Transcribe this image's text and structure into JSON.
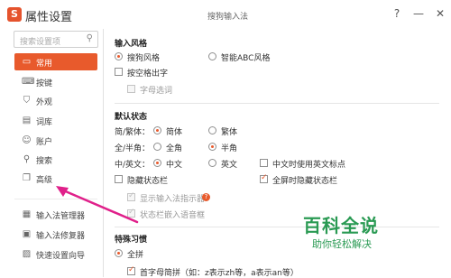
{
  "window": {
    "title": "属性设置",
    "center_title": "搜狗输入法",
    "logo_text": "S",
    "help": "?",
    "minimize": "—",
    "close": "✕"
  },
  "sidebar": {
    "search_placeholder": "搜索设置项",
    "items": [
      {
        "label": "常用",
        "icon": "monitor-icon",
        "glyph": "▭"
      },
      {
        "label": "按键",
        "icon": "keyboard-icon",
        "glyph": "⌨"
      },
      {
        "label": "外观",
        "icon": "shirt-icon",
        "glyph": "⛉"
      },
      {
        "label": "词库",
        "icon": "book-icon",
        "glyph": "▤"
      },
      {
        "label": "账户",
        "icon": "user-icon",
        "glyph": "☺"
      },
      {
        "label": "搜索",
        "icon": "search-icon",
        "glyph": "⚲"
      },
      {
        "label": "高级",
        "icon": "advanced-icon",
        "glyph": "❐"
      }
    ],
    "bottom_items": [
      {
        "label": "输入法管理器",
        "icon": "grid-icon",
        "glyph": "▦"
      },
      {
        "label": "输入法修复器",
        "icon": "repair-icon",
        "glyph": "▣"
      },
      {
        "label": "快速设置向导",
        "icon": "wizard-icon",
        "glyph": "▨"
      }
    ]
  },
  "input_style": {
    "heading": "输入风格",
    "option1": "搜狗风格",
    "option2": "智能ABC风格",
    "space_output": "按空格出字",
    "letter_select": "字母选词"
  },
  "default_state": {
    "heading": "默认状态",
    "simp_trad_label": "简/繁体：",
    "simplified": "简体",
    "traditional": "繁体",
    "width_label": "全/半角：",
    "full_width": "全角",
    "half_width": "半角",
    "cn_en_label": "中/英文：",
    "chinese": "中文",
    "english": "英文",
    "cn_use_en_punct": "中文时使用英文标点",
    "hide_status_bar": "隐藏状态栏",
    "fullscreen_hide": "全屏时隐藏状态栏",
    "show_indicator": "显示输入法指示器",
    "status_voice": "状态栏嵌入语音框",
    "question": "?"
  },
  "special_habits": {
    "heading": "特殊习惯",
    "full_pinyin": "全拼",
    "initial_abbrev": "首字母简拼（如：z表示zh等，a表示an等）"
  },
  "watermark": {
    "title": "百科全说",
    "subtitle": "助你轻松解决"
  },
  "colors": {
    "accent": "#e85a2c",
    "watermark": "#2a9a53",
    "arrow": "#e0208a"
  }
}
